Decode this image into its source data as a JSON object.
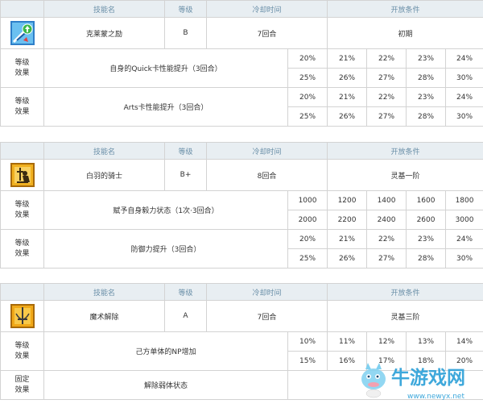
{
  "headers": {
    "skill": "技能名",
    "rank": "等级",
    "cooldown": "冷却时间",
    "unlock": "开放条件"
  },
  "skills": [
    {
      "icon": "quick-up-icon",
      "name": "克莱蒙之励",
      "rank": "B",
      "cooldown": "7回合",
      "unlock": "初期",
      "effects": [
        {
          "label": "等级\n效果",
          "desc": "自身的Quick卡性能提升（3回合）",
          "row1": [
            "20%",
            "21%",
            "22%",
            "23%",
            "24%"
          ],
          "row2": [
            "25%",
            "26%",
            "27%",
            "28%",
            "30%"
          ]
        },
        {
          "label": "等级\n效果",
          "desc": "Arts卡性能提升（3回合）",
          "row1": [
            "20%",
            "21%",
            "22%",
            "23%",
            "24%"
          ],
          "row2": [
            "25%",
            "26%",
            "27%",
            "28%",
            "30%"
          ]
        }
      ]
    },
    {
      "icon": "guts-icon",
      "name": "白羽的骑士",
      "rank": "B+",
      "cooldown": "8回合",
      "unlock": "灵基一阶",
      "effects": [
        {
          "label": "等级\n效果",
          "desc": "赋予自身毅力状态（1次·3回合）",
          "row1": [
            "1000",
            "1200",
            "1400",
            "1600",
            "1800"
          ],
          "row2": [
            "2000",
            "2200",
            "2400",
            "2600",
            "3000"
          ]
        },
        {
          "label": "等级\n效果",
          "desc": "防御力提升（3回合）",
          "row1": [
            "20%",
            "21%",
            "22%",
            "23%",
            "24%"
          ],
          "row2": [
            "25%",
            "26%",
            "27%",
            "28%",
            "30%"
          ]
        }
      ]
    },
    {
      "icon": "sword-icon",
      "name": "魔术解除",
      "rank": "A",
      "cooldown": "7回合",
      "unlock": "灵基三阶",
      "effects": [
        {
          "label": "等级\n效果",
          "desc": "己方单体的NP增加",
          "row1": [
            "10%",
            "11%",
            "12%",
            "13%",
            "14%"
          ],
          "row2": [
            "15%",
            "16%",
            "17%",
            "18%",
            "20%"
          ]
        }
      ],
      "fixed": {
        "label": "固定\n效果",
        "desc": "解除弱体状态"
      }
    }
  ],
  "watermark": {
    "name": "牛游戏网",
    "url": "www.newyx.net",
    "color": "#2a9fd8"
  }
}
